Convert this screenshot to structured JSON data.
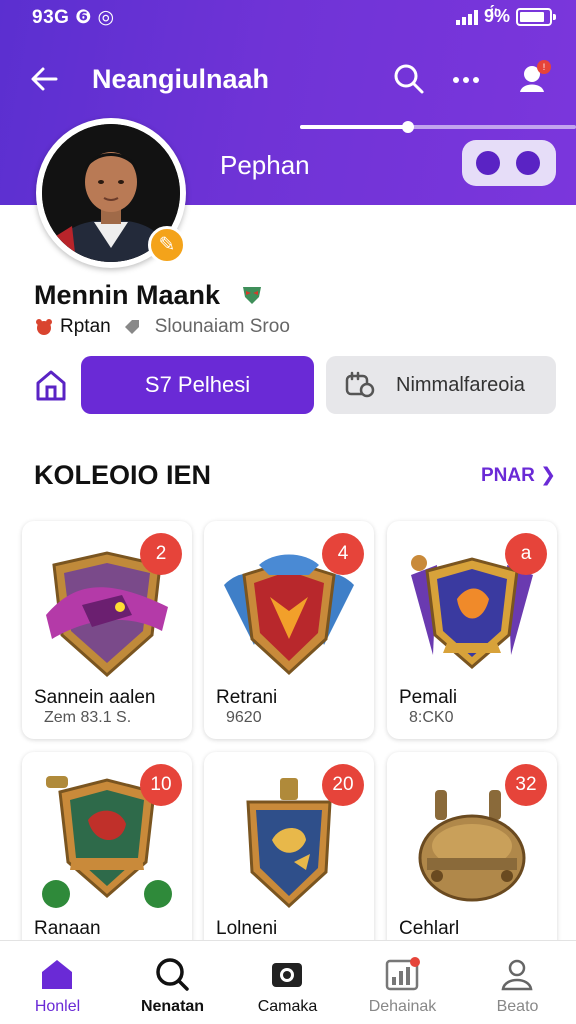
{
  "status_bar": {
    "time": "93G ❻ ◎",
    "battery_text": "9̈́%",
    "battery_level": 0.85
  },
  "header": {
    "title": "Neangiulnaah",
    "name": "Pephan",
    "slider_value": 0.39
  },
  "profile": {
    "name": "Mennin Maank",
    "role": "Rptan",
    "meta": "Slounaiam Sroo"
  },
  "actions": {
    "primary_label": "S7 Pelhesi",
    "secondary_label": "Nimmalfareoia"
  },
  "section": {
    "title": "KOLEOIO IEN",
    "link": "PNAR"
  },
  "collection": [
    {
      "title": "Sannein aalen",
      "meta": "Zem 83.1 S.",
      "badge": "2"
    },
    {
      "title": "Retrani",
      "meta": "9620",
      "badge": "4"
    },
    {
      "title": "Pemali",
      "meta": "8:CK0",
      "badge": "a"
    },
    {
      "title": "Ranaan",
      "meta": "",
      "badge": "10"
    },
    {
      "title": "Lolneni",
      "meta": "",
      "badge": "20"
    },
    {
      "title": "Cehlarl",
      "meta": "",
      "badge": "32"
    }
  ],
  "bottom_nav": [
    {
      "label": "Honlel",
      "icon": "home-icon",
      "color": "#6a2ad6"
    },
    {
      "label": "Nenatan",
      "icon": "search-icon",
      "color": "#111111"
    },
    {
      "label": "Camaka",
      "icon": "camera-icon",
      "color": "#111111"
    },
    {
      "label": "Dehainak",
      "icon": "dashboard-icon",
      "color": "#888888"
    },
    {
      "label": "Beato",
      "icon": "profile-icon",
      "color": "#888888"
    }
  ],
  "colors": {
    "accent": "#6a2ad6",
    "header": "#6a32d4",
    "badge": "#e6443a"
  }
}
